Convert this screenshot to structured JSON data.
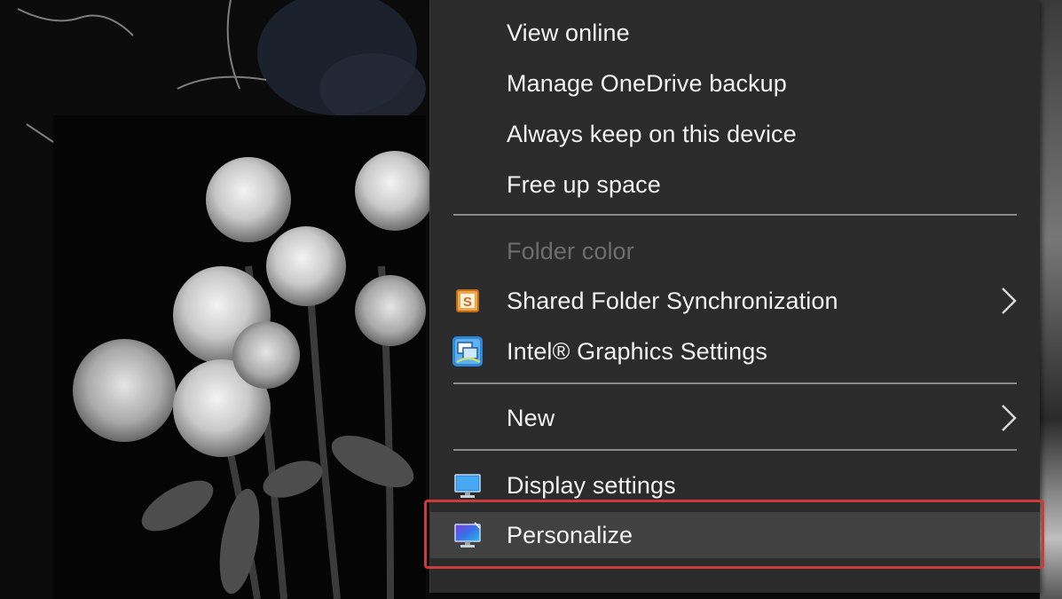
{
  "context_menu": {
    "items": [
      {
        "label": "View online"
      },
      {
        "label": "Manage OneDrive backup"
      },
      {
        "label": "Always keep on this device"
      },
      {
        "label": "Free up space"
      },
      {
        "label": "Folder color",
        "disabled": true
      },
      {
        "label": "Shared Folder Synchronization",
        "icon": "shared-folder-sync-icon",
        "submenu": true
      },
      {
        "label": "Intel® Graphics Settings",
        "icon": "intel-graphics-icon"
      },
      {
        "label": "New",
        "submenu": true
      },
      {
        "label": "Display settings",
        "icon": "display-settings-icon"
      },
      {
        "label": "Personalize",
        "icon": "personalize-icon",
        "highlighted": true
      }
    ]
  },
  "annotation": {
    "highlight_color": "#cc3b3b",
    "highlighted_item": "Personalize"
  },
  "colors": {
    "menu_bg": "#2b2b2b",
    "menu_text": "#f2f2f2",
    "disabled_text": "#6d6d6d",
    "hover_bg": "#414141"
  }
}
